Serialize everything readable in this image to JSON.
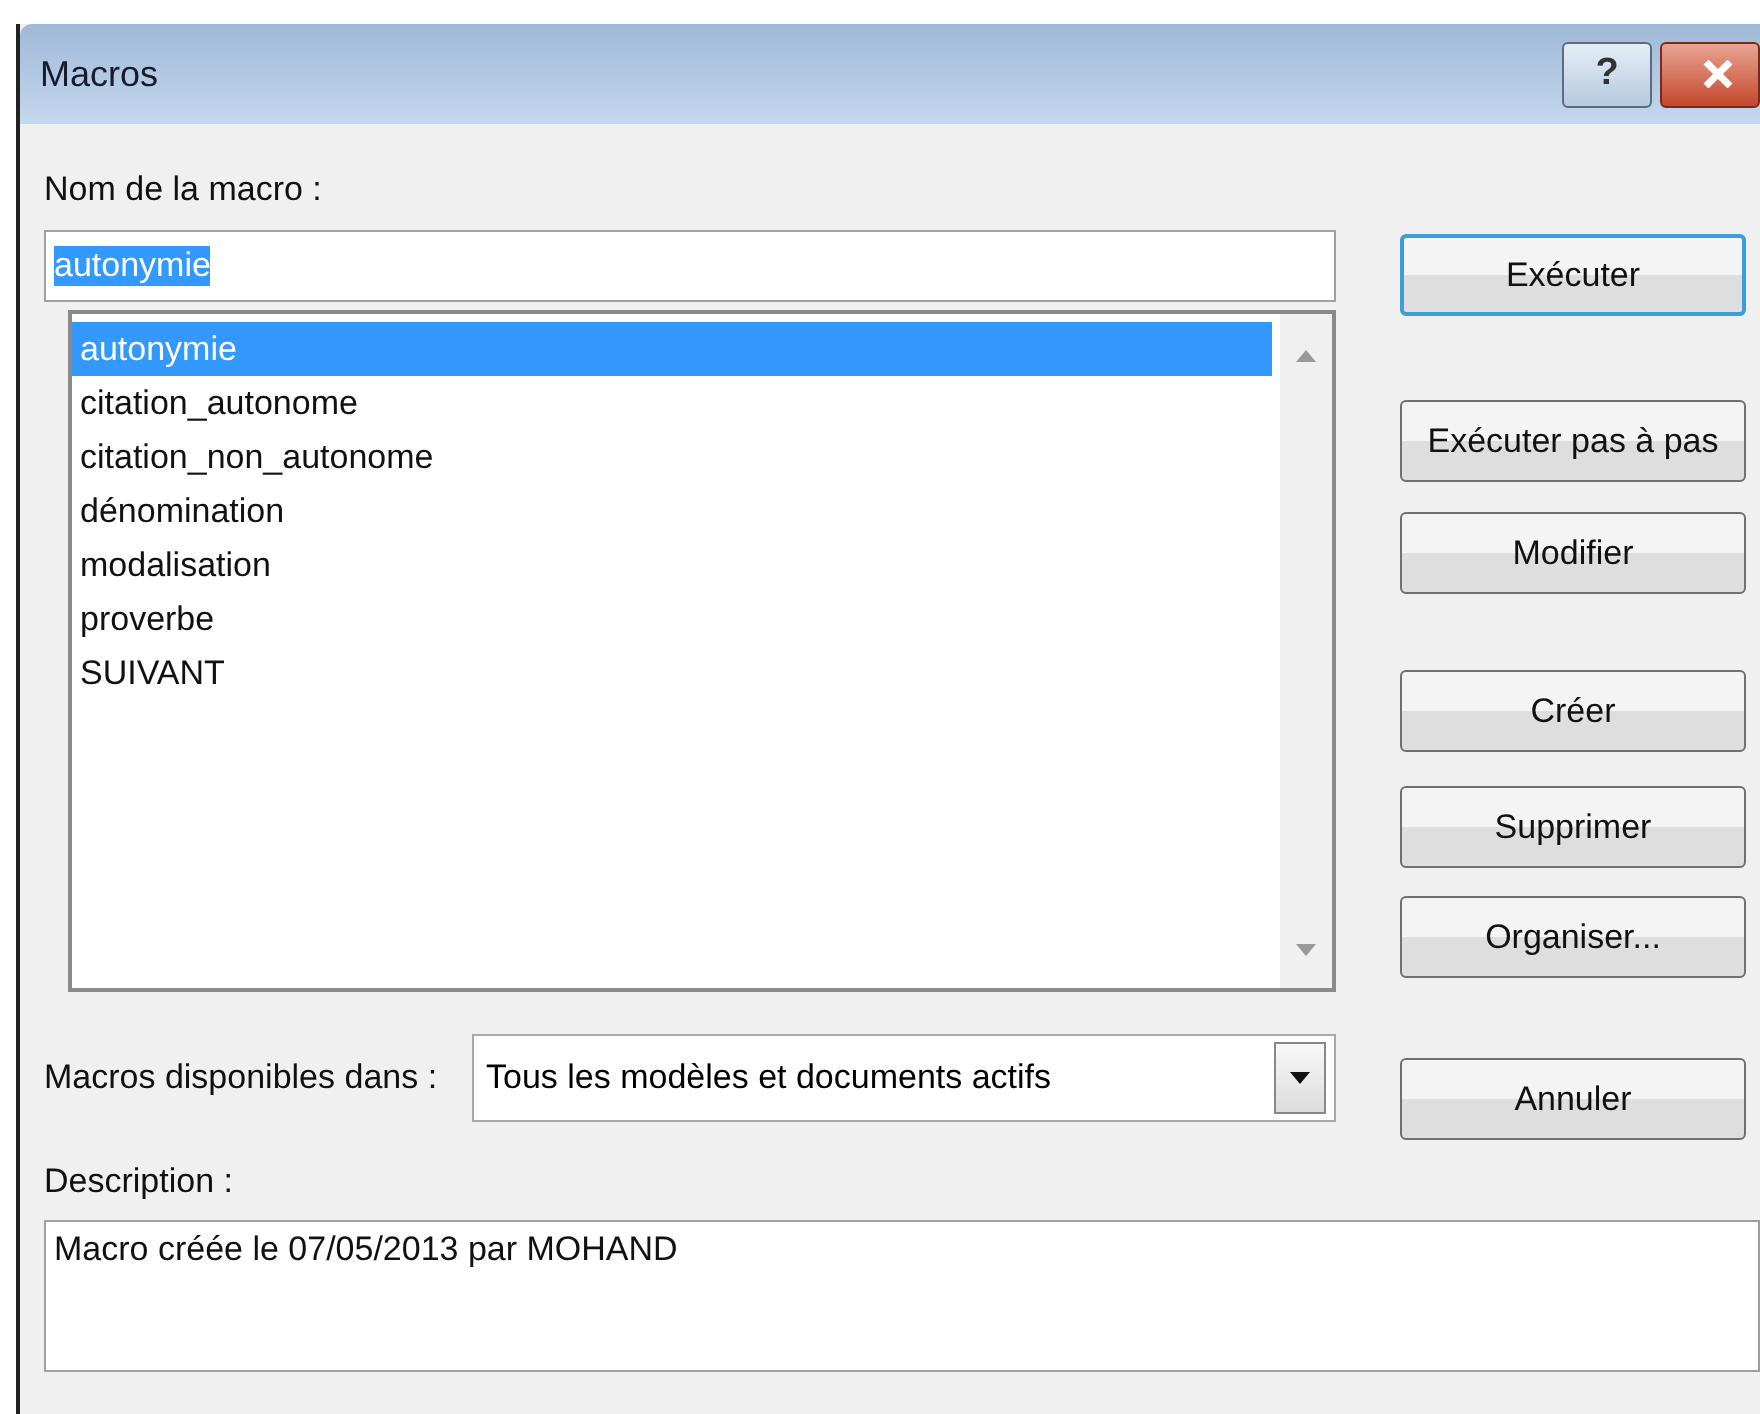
{
  "window": {
    "title": "Macros",
    "controls": [
      {
        "kind": "help",
        "label": "?"
      },
      {
        "kind": "close"
      }
    ]
  },
  "macro_name": {
    "label": "Nom de la macro :",
    "value": "autonymie",
    "highlighted": true
  },
  "macros": [
    {
      "name": "autonymie",
      "selected": true
    },
    {
      "name": "citation_autonome",
      "selected": false
    },
    {
      "name": "citation_non_autonome",
      "selected": false
    },
    {
      "name": "dénomination",
      "selected": false
    },
    {
      "name": "modalisation",
      "selected": false
    },
    {
      "name": "proverbe",
      "selected": false
    },
    {
      "name": "SUIVANT",
      "selected": false
    }
  ],
  "buttons": [
    {
      "label": "Exécuter",
      "default": true
    },
    {
      "label": "Exécuter pas à pas",
      "default": false
    },
    {
      "label": "Modifier",
      "default": false
    },
    {
      "label": "Créer",
      "default": false
    },
    {
      "label": "Supprimer",
      "default": false
    },
    {
      "label": "Organiser...",
      "default": false
    },
    {
      "label": "Annuler",
      "default": false
    }
  ],
  "available_in": {
    "label": "Macros disponibles dans :",
    "value": "Tous les modèles et documents actifs"
  },
  "description": {
    "label": "Description :",
    "value": "Macro créée le 07/05/2013 par MOHAND"
  }
}
